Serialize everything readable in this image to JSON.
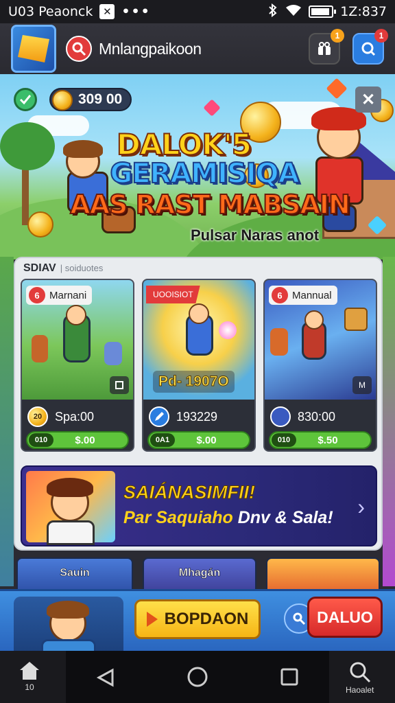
{
  "status_bar": {
    "left_text": "U03 Peaonck",
    "dots": "•••",
    "time": "1Z:837"
  },
  "header": {
    "app_name": "Mnlangpaikoon",
    "gift_badge": "1",
    "profile_badge": "1"
  },
  "hero": {
    "coin_balance": "309 00",
    "close_glyph": "✕",
    "title_line1": "DALOK'5",
    "title_line2": "GERAMISIQA",
    "title_line3": "AAS RAST MABSAIN",
    "subtitle": "Pulsar Naras anot"
  },
  "section": {
    "title": "SDIAV",
    "subtitle": "| soiduotes"
  },
  "cards": [
    {
      "tag_number": "6",
      "tag_label": "Marnani",
      "art_label": "",
      "mini_label": "",
      "stat": "Spa:00",
      "price_chip": "010",
      "price": "$.00",
      "coin_label": "20"
    },
    {
      "ribbon_label": "UOOISIOT",
      "art_label": "Pd- 1907O",
      "stat": "193229",
      "price_chip": "0A1",
      "price": "$.00"
    },
    {
      "tag_number": "6",
      "tag_label": "Mannual",
      "mini_label": "M",
      "stat": "830:00",
      "price_chip": "010",
      "price": "$.50"
    }
  ],
  "promo": {
    "line1": "SAIÁNASIMFII!",
    "line2_prefix": "Par Saquiaho",
    "line2_suffix": "Dnv & Sala!",
    "chevron": "›"
  },
  "strips": [
    {
      "label": "Sauin"
    },
    {
      "label": "Mhagán"
    },
    {
      "label": ""
    }
  ],
  "action_bar": {
    "play_label": "BOPDAON",
    "dalio_label": "DALUO"
  },
  "nav": {
    "home_label": "10",
    "search_label": "Haoalet"
  },
  "colors": {
    "accent_yellow": "#ffd21a",
    "accent_red": "#e23b3b",
    "accent_blue": "#2a7de0",
    "price_green": "#5ec43b"
  }
}
